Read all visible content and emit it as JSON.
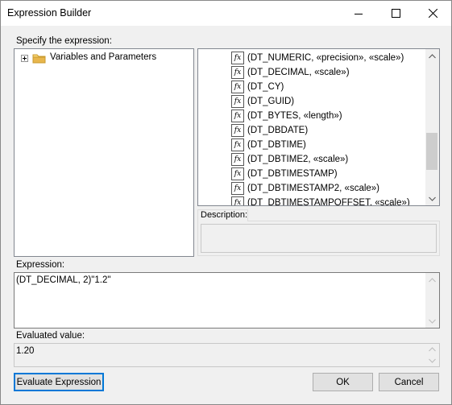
{
  "window": {
    "title": "Expression Builder"
  },
  "expression_section": {
    "label": "Specify the expression:"
  },
  "tree": {
    "items": [
      {
        "label": "Variables and Parameters",
        "icon": "folder-icon",
        "expanded": false
      }
    ]
  },
  "functions": {
    "items": [
      "(DT_NUMERIC, «precision», «scale»)",
      "(DT_DECIMAL, «scale»)",
      "(DT_CY)",
      "(DT_GUID)",
      "(DT_BYTES, «length»)",
      "(DT_DBDATE)",
      "(DT_DBTIME)",
      "(DT_DBTIME2, «scale»)",
      "(DT_DBTIMESTAMP)",
      "(DT_DBTIMESTAMP2, «scale»)",
      "(DT_DBTIMESTAMPOFFSET, «scale»)"
    ],
    "item_icon": "fx-icon",
    "scroll_fraction": 0.6
  },
  "description": {
    "label": "Description:",
    "value": ""
  },
  "expression": {
    "label": "Expression:",
    "value": "(DT_DECIMAL, 2)\"1.2\""
  },
  "evaluated": {
    "label": "Evaluated value:",
    "value": "1.20"
  },
  "buttons": {
    "evaluate": "Evaluate Expression",
    "ok": "OK",
    "cancel": "Cancel"
  },
  "colors": {
    "focus": "#0078d7",
    "button_face": "#e1e1e1",
    "dialog_bg": "#f0f0f0",
    "folder": "#e8b64c"
  }
}
